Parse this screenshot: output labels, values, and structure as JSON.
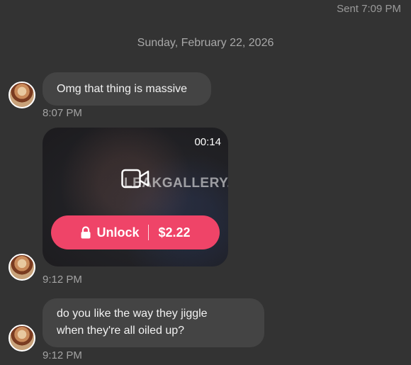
{
  "header": {
    "sent_status": "Sent 7:09 PM"
  },
  "date_separator": "Sunday, February 22, 2026",
  "messages": [
    {
      "text": "Omg that thing is massive",
      "time": "8:07 PM"
    },
    {
      "media": {
        "duration": "00:14",
        "watermark": "LEAKGALLERY.COM",
        "icon": "video-camera-icon",
        "unlock_label": "Unlock",
        "price": "$2.22"
      },
      "time": "9:12 PM"
    },
    {
      "text_line1": "do you like the way they jiggle",
      "text_line2": "when they're all oiled up?",
      "time": "9:12 PM"
    }
  ],
  "colors": {
    "background": "#333333",
    "bubble": "#444444",
    "unlock_button": "#ef4468"
  }
}
